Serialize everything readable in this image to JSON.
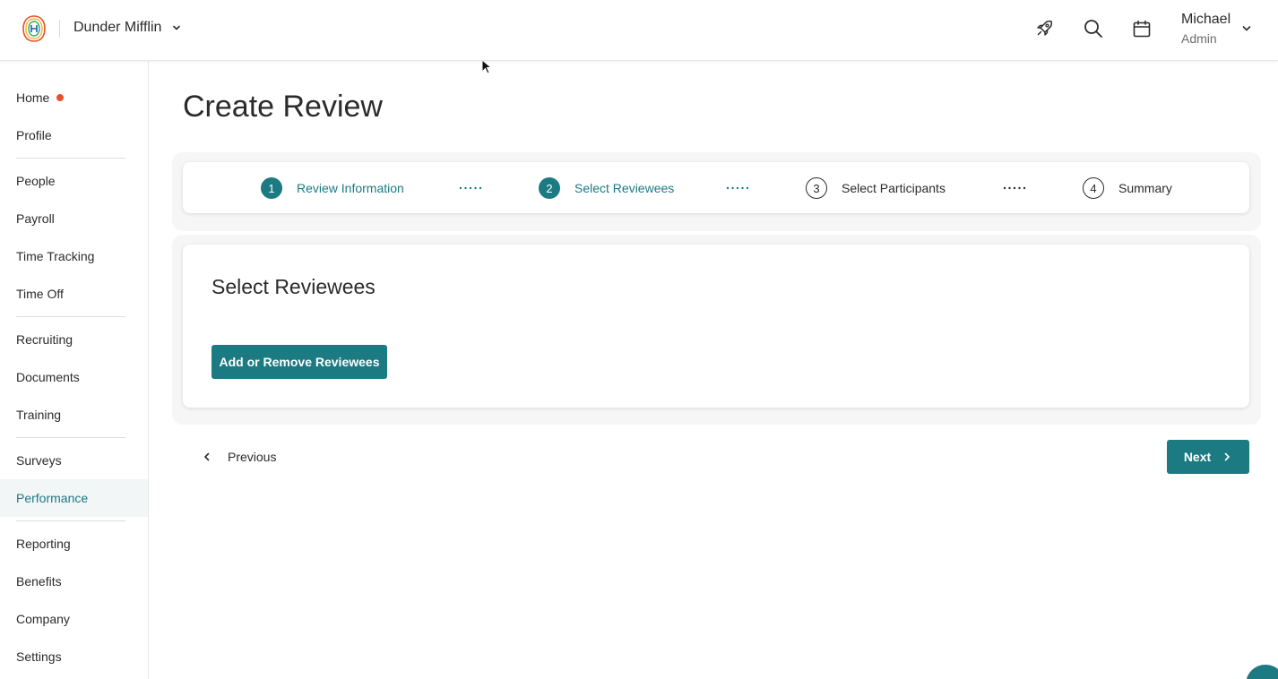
{
  "header": {
    "company_name": "Dunder Mifflin",
    "icons": [
      "rocket-icon",
      "search-icon",
      "calendar-icon"
    ],
    "user": {
      "name": "Michael",
      "role": "Admin"
    }
  },
  "sidebar": {
    "items": [
      {
        "label": "Home",
        "badge_dot": true
      },
      {
        "label": "Profile"
      },
      {
        "label": "People"
      },
      {
        "label": "Payroll"
      },
      {
        "label": "Time Tracking"
      },
      {
        "label": "Time Off"
      },
      {
        "label": "Recruiting"
      },
      {
        "label": "Documents"
      },
      {
        "label": "Training"
      },
      {
        "label": "Surveys"
      },
      {
        "label": "Performance",
        "active": true
      },
      {
        "label": "Reporting"
      },
      {
        "label": "Benefits"
      },
      {
        "label": "Company"
      },
      {
        "label": "Settings"
      }
    ]
  },
  "main": {
    "title": "Create Review",
    "steps": [
      {
        "number": "1",
        "label": "Review Information",
        "state": "done"
      },
      {
        "number": "2",
        "label": "Select Reviewees",
        "state": "current"
      },
      {
        "number": "3",
        "label": "Select Participants",
        "state": "todo"
      },
      {
        "number": "4",
        "label": "Summary",
        "state": "todo"
      }
    ],
    "card": {
      "title": "Select Reviewees",
      "button_label": "Add or Remove Reviewees"
    },
    "previous_label": "Previous",
    "next_label": "Next"
  },
  "colors": {
    "accent": "#1b7a82",
    "notification_dot": "#e8502a",
    "active_nav_bg": "#f3f6f6"
  }
}
